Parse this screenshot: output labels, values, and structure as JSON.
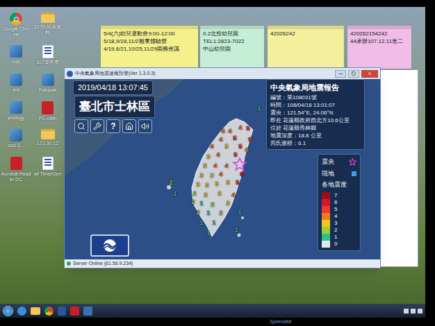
{
  "bezel": {
    "brand": "Splendid"
  },
  "desktop_icons": [
    {
      "label": "Google Chrome",
      "kind": "chrome"
    },
    {
      "label": "107幼兒園資料",
      "kind": "folder"
    },
    {
      "label": "ogy",
      "kind": "app"
    },
    {
      "label": "107學年度",
      "kind": "word"
    },
    {
      "label": "ent",
      "kind": "app"
    },
    {
      "label": "Kalopak",
      "kind": "app"
    },
    {
      "label": "ynology",
      "kind": "app"
    },
    {
      "label": "PC-cillin",
      "kind": "pdf"
    },
    {
      "label": "oud S...",
      "kind": "app"
    },
    {
      "label": "172.30.12",
      "kind": "folder"
    },
    {
      "label": "Acrobat Reader DC",
      "kind": "pdf"
    },
    {
      "label": "wf TimerGen",
      "kind": "word"
    }
  ],
  "sticky_notes": [
    {
      "lines": [
        "5/4(六)幼兒運動會9:00-12:00",
        "5/18,9/28,11/2難童體驗營",
        "4/19,6/21,10/25,11/29園務會議"
      ],
      "color": "#f6f08c"
    },
    {
      "lines": [
        "0.2北投幼兒園",
        "TEL1:2823-7022",
        "中山幼兒園"
      ],
      "color": "#c6eed6"
    },
    {
      "lines": [
        "42026242"
      ],
      "color": "#f3ef9c"
    },
    {
      "lines": [
        "420262154242",
        "44承辦107.12.11進二"
      ],
      "color": "#f0bde8"
    }
  ],
  "window": {
    "title": "中央氣象局地震速報預警(Ver 1.3.0.3)"
  },
  "app": {
    "timestamp": "2019/04/18 13:07:45",
    "location": "臺北市士林區",
    "toolbar": [
      {
        "kind": "search"
      },
      {
        "kind": "wrench"
      },
      {
        "kind": "text",
        "label": "?"
      },
      {
        "kind": "home"
      },
      {
        "kind": "sound"
      }
    ],
    "report": {
      "title": "中央氣象局地震報告",
      "lines": [
        "編號：第108031號",
        "時間：108/04/18 13:01:07",
        "震央：121.54°E, 24.06°N",
        "即在 花蓮縣政府西北方10.6公里",
        "位於 花蓮縣秀林鄉",
        "地震深度：18.8 公里",
        "芮氏規模：6.1"
      ]
    },
    "legend": {
      "epicenter": "震央",
      "local": "現地",
      "intensity_title": "各地震度",
      "levels": [
        {
          "value": "7",
          "color": "#9c0e1c"
        },
        {
          "value": "6",
          "color": "#d7172f"
        },
        {
          "value": "5",
          "color": "#ea3b2e"
        },
        {
          "value": "4",
          "color": "#f07a22"
        },
        {
          "value": "3",
          "color": "#f3c623"
        },
        {
          "value": "2",
          "color": "#9ccf3a"
        },
        {
          "value": "1",
          "color": "#2fbf8f"
        },
        {
          "value": "0",
          "color": "#e6e6e6"
        }
      ]
    },
    "readings": [
      {
        "value": "1",
        "color": "#2fbf8f"
      },
      {
        "value": "4",
        "color": "#f07a22"
      },
      {
        "value": "4",
        "color": "#f07a22"
      },
      {
        "value": "4",
        "color": "#f07a22"
      },
      {
        "value": "5",
        "color": "#ea3b2e"
      },
      {
        "value": "5",
        "color": "#ea3b2e"
      },
      {
        "value": "4",
        "color": "#f07a22"
      },
      {
        "value": "4",
        "color": "#f07a22"
      },
      {
        "value": "3",
        "color": "#f3c623"
      },
      {
        "value": "5",
        "color": "#ea3b2e"
      },
      {
        "value": "5",
        "color": "#ea3b2e"
      },
      {
        "value": "3",
        "color": "#f3c623"
      },
      {
        "value": "4",
        "color": "#f07a22"
      },
      {
        "value": "5",
        "color": "#ea3b2e"
      },
      {
        "value": "4",
        "color": "#f07a22"
      },
      {
        "value": "3",
        "color": "#f3c623"
      },
      {
        "value": "4",
        "color": "#f07a22"
      },
      {
        "value": "4",
        "color": "#f07a22"
      },
      {
        "value": "6",
        "color": "#d7172f"
      },
      {
        "value": "3",
        "color": "#f3c623"
      },
      {
        "value": "3",
        "color": "#f3c623"
      },
      {
        "value": "4",
        "color": "#f07a22"
      },
      {
        "value": "3",
        "color": "#f3c623"
      },
      {
        "value": "3",
        "color": "#f3c623"
      },
      {
        "value": "3",
        "color": "#f3c623"
      },
      {
        "value": "3",
        "color": "#f3c623"
      },
      {
        "value": "5",
        "color": "#ea3b2e"
      },
      {
        "value": "2",
        "color": "#9ccf3a"
      },
      {
        "value": "3",
        "color": "#f3c623"
      },
      {
        "value": "3",
        "color": "#f3c623"
      },
      {
        "value": "4",
        "color": "#f07a22"
      },
      {
        "value": "2",
        "color": "#9ccf3a"
      },
      {
        "value": "1",
        "color": "#2fbf8f"
      },
      {
        "value": "2",
        "color": "#9ccf3a"
      },
      {
        "value": "3",
        "color": "#f3c623"
      },
      {
        "value": "2",
        "color": "#9ccf3a"
      },
      {
        "value": "1",
        "color": "#2fbf8f"
      },
      {
        "value": "2",
        "color": "#9ccf3a"
      },
      {
        "value": "1",
        "color": "#2fbf8f"
      },
      {
        "value": "1",
        "color": "#2fbf8f"
      },
      {
        "value": "1",
        "color": "#2fbf8f"
      },
      {
        "value": "1",
        "color": "#2fbf8f"
      },
      {
        "value": "2",
        "color": "#9ccf3a"
      },
      {
        "value": "1",
        "color": "#2fbf8f"
      },
      {
        "value": "1",
        "color": "#2fbf8f"
      }
    ],
    "status": "Server Online (61.56.9.234)"
  }
}
